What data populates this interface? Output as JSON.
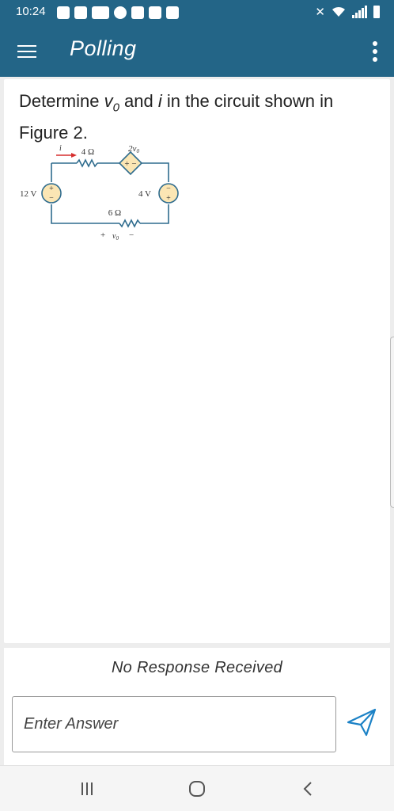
{
  "status_bar": {
    "time": "10:24",
    "mute_icon": "bell-off-icon",
    "icons": [
      "dropbox-icon",
      "bag-icon",
      "email-icon",
      "spotify-icon",
      "gallery-icon",
      "video-icon",
      "weather-icon"
    ]
  },
  "app_bar": {
    "title": "Polling",
    "menu_icon": "hamburger-menu-icon",
    "more_icon": "more-vertical-icon",
    "background": "#236587"
  },
  "question": {
    "text_before": "Determine ",
    "var_v": "v",
    "var_v_sub": "0",
    "text_mid": " and ",
    "var_i": "i",
    "text_after": " in the circuit shown in Figure 2.",
    "figure": {
      "current_label": "i",
      "r1_label": "4 Ω",
      "dep_source_label": "2v",
      "dep_source_sub": "0",
      "source1_label": "12 V",
      "source2_label": "4 V",
      "r2_label": "6 Ω",
      "plus": "+",
      "minus": "−",
      "vo_label": "v",
      "vo_sub": "0",
      "wire_color": "#2f6c8e",
      "current_arrow_color": "#d62e2e",
      "source_fill": "#fbe6b4"
    }
  },
  "response": {
    "status": "No Response Received",
    "input_placeholder": "Enter Answer",
    "send_icon": "send-icon",
    "accent": "#1c82c6"
  },
  "nav_bar": {
    "recents_icon": "recents-icon",
    "home_icon": "home-icon",
    "back_icon": "back-icon"
  }
}
